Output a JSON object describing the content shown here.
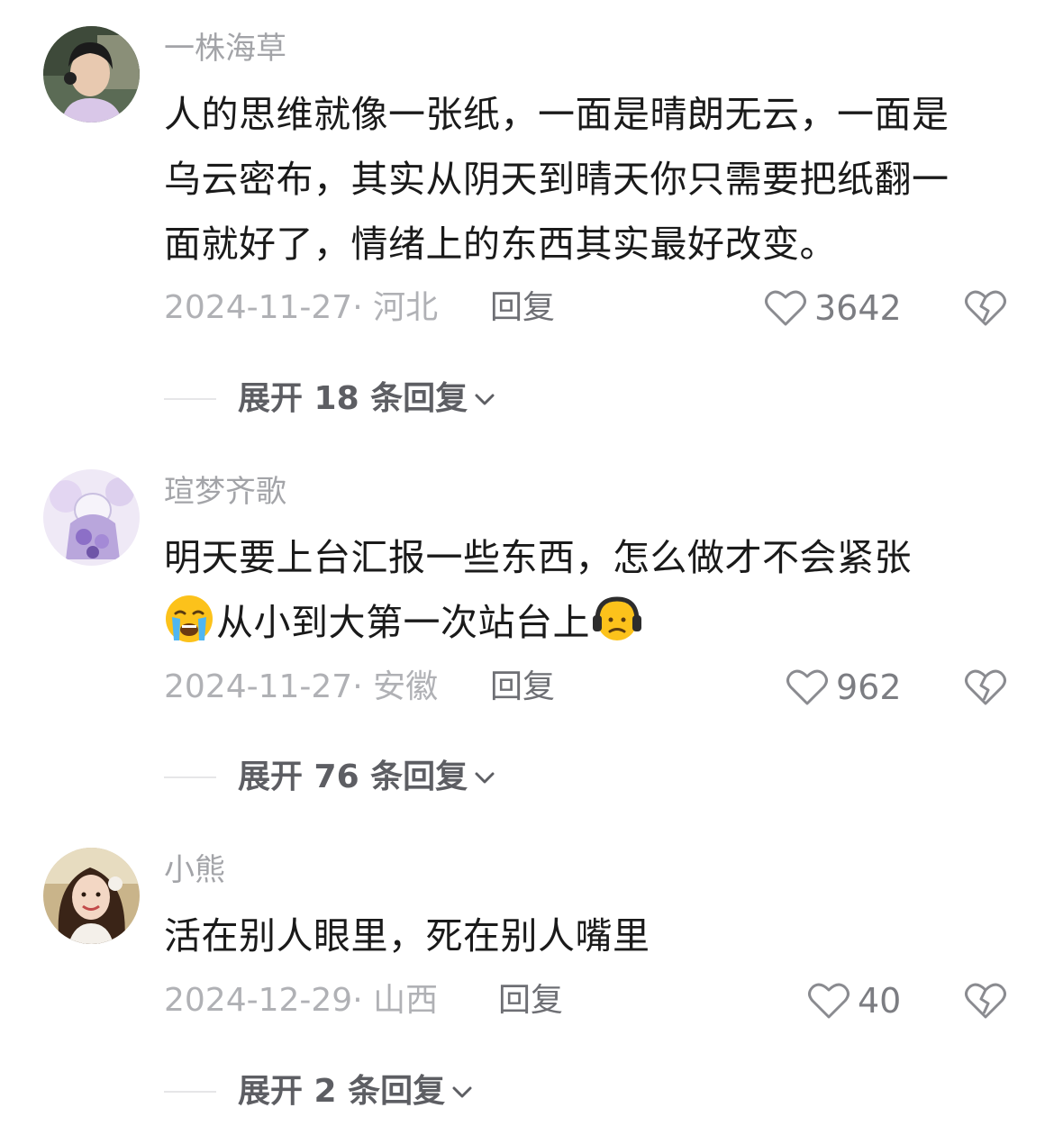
{
  "comments": [
    {
      "username": "一株海草",
      "lines": [
        "人的思维就像一张纸，一面是晴朗无云，一面是",
        "乌云密布，其实从阴天到晴天你只需要把纸翻一",
        "面就好了，情绪上的东西其实最好改变。"
      ],
      "date_location": "2024-11-27· 河北",
      "reply_label": "回复",
      "likes": "3642",
      "expand_label": "展开 18 条回复"
    },
    {
      "username": "瑄梦齐歌",
      "line1": "明天要上台汇报一些东西，怎么做才不会紧张",
      "line2_text": "从小到大第一次站台上",
      "emojis": [
        "crying-face-emoji",
        "headphones-face-emoji"
      ],
      "date_location": "2024-11-27· 安徽",
      "reply_label": "回复",
      "likes": "962",
      "expand_label": "展开 76 条回复"
    },
    {
      "username": "小熊",
      "lines": [
        "活在别人眼里，死在别人嘴里"
      ],
      "date_location": "2024-12-29· 山西",
      "reply_label": "回复",
      "likes": "40",
      "expand_label": "展开 2 条回复"
    }
  ],
  "icons": {
    "like": "heart-outline-icon",
    "dislike": "broken-heart-icon",
    "expand": "chevron-down-icon"
  },
  "colors": {
    "username": "#a3a4a8",
    "content": "#1a1a1a",
    "meta": "#b0b1b5",
    "reply": "#6e6f74"
  }
}
